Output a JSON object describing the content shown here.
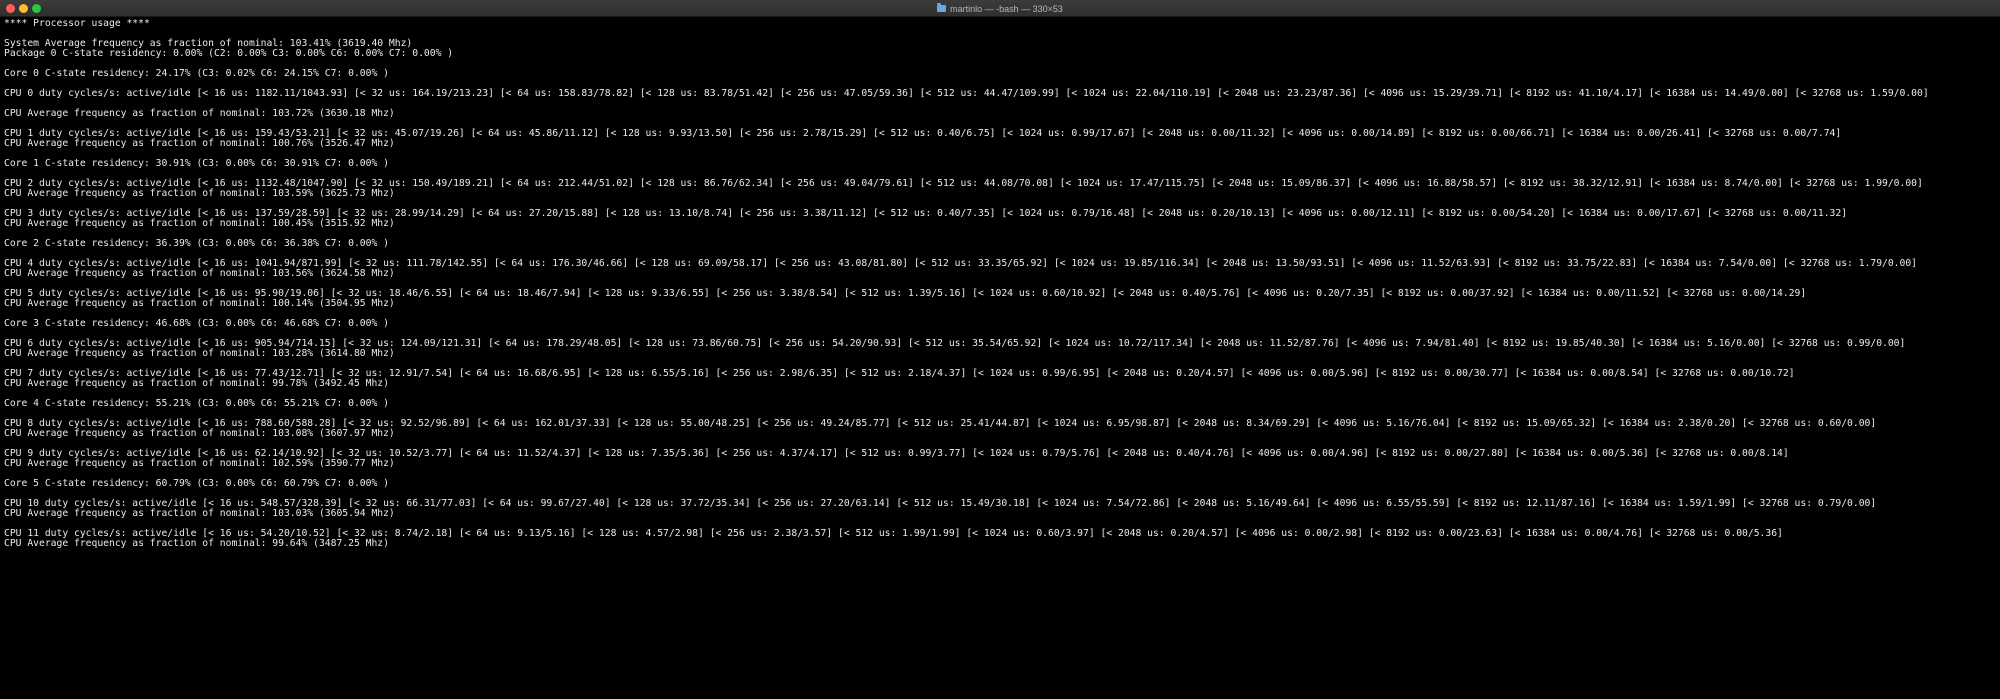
{
  "window": {
    "title": "martinlo — -bash — 330×53",
    "title_icon": "folder-icon",
    "colors": {
      "background": "#000000",
      "text": "#ebebeb",
      "titlebar": "#333333",
      "close": "#ff5f57",
      "minimize": "#febc2e",
      "maximize": "#28c840"
    }
  },
  "terminal": {
    "lines": [
      "**** Processor usage ****",
      "",
      "System Average frequency as fraction of nominal: 103.41% (3619.40 Mhz)",
      "Package 0 C-state residency: 0.00% (C2: 0.00% C3: 0.00% C6: 0.00% C7: 0.00% )",
      "",
      "Core 0 C-state residency: 24.17% (C3: 0.02% C6: 24.15% C7: 0.00% )",
      "",
      "CPU 0 duty cycles/s: active/idle [< 16 us: 1182.11/1043.93] [< 32 us: 164.19/213.23] [< 64 us: 158.83/78.82] [< 128 us: 83.78/51.42] [< 256 us: 47.05/59.36] [< 512 us: 44.47/109.99] [< 1024 us: 22.04/110.19] [< 2048 us: 23.23/87.36] [< 4096 us: 15.29/39.71] [< 8192 us: 41.10/4.17] [< 16384 us: 14.49/0.00] [< 32768 us: 1.59/0.00]",
      "",
      "CPU Average frequency as fraction of nominal: 103.72% (3630.18 Mhz)",
      "",
      "CPU 1 duty cycles/s: active/idle [< 16 us: 159.43/53.21] [< 32 us: 45.07/19.26] [< 64 us: 45.86/11.12] [< 128 us: 9.93/13.50] [< 256 us: 2.78/15.29] [< 512 us: 0.40/6.75] [< 1024 us: 0.99/17.67] [< 2048 us: 0.00/11.32] [< 4096 us: 0.00/14.89] [< 8192 us: 0.00/66.71] [< 16384 us: 0.00/26.41] [< 32768 us: 0.00/7.74]",
      "CPU Average frequency as fraction of nominal: 100.76% (3526.47 Mhz)",
      "",
      "Core 1 C-state residency: 30.91% (C3: 0.00% C6: 30.91% C7: 0.00% )",
      "",
      "CPU 2 duty cycles/s: active/idle [< 16 us: 1132.48/1047.90] [< 32 us: 150.49/189.21] [< 64 us: 212.44/51.02] [< 128 us: 86.76/62.34] [< 256 us: 49.04/79.61] [< 512 us: 44.08/70.08] [< 1024 us: 17.47/115.75] [< 2048 us: 15.09/86.37] [< 4096 us: 16.88/58.57] [< 8192 us: 38.32/12.91] [< 16384 us: 8.74/0.00] [< 32768 us: 1.99/0.00]",
      "CPU Average frequency as fraction of nominal: 103.59% (3625.73 Mhz)",
      "",
      "CPU 3 duty cycles/s: active/idle [< 16 us: 137.59/28.59] [< 32 us: 28.99/14.29] [< 64 us: 27.20/15.88] [< 128 us: 13.10/8.74] [< 256 us: 3.38/11.12] [< 512 us: 0.40/7.35] [< 1024 us: 0.79/16.48] [< 2048 us: 0.20/10.13] [< 4096 us: 0.00/12.11] [< 8192 us: 0.00/54.20] [< 16384 us: 0.00/17.67] [< 32768 us: 0.00/11.32]",
      "CPU Average frequency as fraction of nominal: 100.45% (3515.92 Mhz)",
      "",
      "Core 2 C-state residency: 36.39% (C3: 0.00% C6: 36.38% C7: 0.00% )",
      "",
      "CPU 4 duty cycles/s: active/idle [< 16 us: 1041.94/871.99] [< 32 us: 111.78/142.55] [< 64 us: 176.30/46.66] [< 128 us: 69.09/58.17] [< 256 us: 43.08/81.80] [< 512 us: 33.35/65.92] [< 1024 us: 19.85/116.34] [< 2048 us: 13.50/93.51] [< 4096 us: 11.52/63.93] [< 8192 us: 33.75/22.83] [< 16384 us: 7.54/0.00] [< 32768 us: 1.79/0.00]",
      "CPU Average frequency as fraction of nominal: 103.56% (3624.58 Mhz)",
      "",
      "CPU 5 duty cycles/s: active/idle [< 16 us: 95.90/19.06] [< 32 us: 18.46/6.55] [< 64 us: 18.46/7.94] [< 128 us: 9.33/6.55] [< 256 us: 3.38/8.54] [< 512 us: 1.39/5.16] [< 1024 us: 0.60/10.92] [< 2048 us: 0.40/5.76] [< 4096 us: 0.20/7.35] [< 8192 us: 0.00/37.92] [< 16384 us: 0.00/11.52] [< 32768 us: 0.00/14.29]",
      "CPU Average frequency as fraction of nominal: 100.14% (3504.95 Mhz)",
      "",
      "Core 3 C-state residency: 46.68% (C3: 0.00% C6: 46.68% C7: 0.00% )",
      "",
      "CPU 6 duty cycles/s: active/idle [< 16 us: 905.94/714.15] [< 32 us: 124.09/121.31] [< 64 us: 178.29/48.05] [< 128 us: 73.86/60.75] [< 256 us: 54.20/90.93] [< 512 us: 35.54/65.92] [< 1024 us: 10.72/117.34] [< 2048 us: 11.52/87.76] [< 4096 us: 7.94/81.40] [< 8192 us: 19.85/40.30] [< 16384 us: 5.16/0.00] [< 32768 us: 0.99/0.00]",
      "CPU Average frequency as fraction of nominal: 103.28% (3614.80 Mhz)",
      "",
      "CPU 7 duty cycles/s: active/idle [< 16 us: 77.43/12.71] [< 32 us: 12.91/7.54] [< 64 us: 16.68/6.95] [< 128 us: 6.55/5.16] [< 256 us: 2.98/6.35] [< 512 us: 2.18/4.37] [< 1024 us: 0.99/6.95] [< 2048 us: 0.20/4.57] [< 4096 us: 0.00/5.96] [< 8192 us: 0.00/30.77] [< 16384 us: 0.00/8.54] [< 32768 us: 0.00/10.72]",
      "CPU Average frequency as fraction of nominal: 99.78% (3492.45 Mhz)",
      "",
      "Core 4 C-state residency: 55.21% (C3: 0.00% C6: 55.21% C7: 0.00% )",
      "",
      "CPU 8 duty cycles/s: active/idle [< 16 us: 788.60/588.28] [< 32 us: 92.52/96.89] [< 64 us: 162.01/37.33] [< 128 us: 55.00/48.25] [< 256 us: 49.24/85.77] [< 512 us: 25.41/44.87] [< 1024 us: 6.95/98.87] [< 2048 us: 8.34/69.29] [< 4096 us: 5.16/76.04] [< 8192 us: 15.09/65.32] [< 16384 us: 2.38/0.20] [< 32768 us: 0.60/0.00]",
      "CPU Average frequency as fraction of nominal: 103.08% (3607.97 Mhz)",
      "",
      "CPU 9 duty cycles/s: active/idle [< 16 us: 62.14/10.92] [< 32 us: 10.52/3.77] [< 64 us: 11.52/4.37] [< 128 us: 7.35/5.36] [< 256 us: 4.37/4.17] [< 512 us: 0.99/3.77] [< 1024 us: 0.79/5.76] [< 2048 us: 0.40/4.76] [< 4096 us: 0.00/4.96] [< 8192 us: 0.00/27.80] [< 16384 us: 0.00/5.36] [< 32768 us: 0.00/8.14]",
      "CPU Average frequency as fraction of nominal: 102.59% (3590.77 Mhz)",
      "",
      "Core 5 C-state residency: 60.79% (C3: 0.00% C6: 60.79% C7: 0.00% )",
      "",
      "CPU 10 duty cycles/s: active/idle [< 16 us: 548.57/328.39] [< 32 us: 66.31/77.03] [< 64 us: 99.67/27.40] [< 128 us: 37.72/35.34] [< 256 us: 27.20/63.14] [< 512 us: 15.49/30.18] [< 1024 us: 7.54/72.86] [< 2048 us: 5.16/49.64] [< 4096 us: 6.55/55.59] [< 8192 us: 12.11/87.16] [< 16384 us: 1.59/1.99] [< 32768 us: 0.79/0.00]",
      "CPU Average frequency as fraction of nominal: 103.03% (3605.94 Mhz)",
      "",
      "CPU 11 duty cycles/s: active/idle [< 16 us: 54.20/10.52] [< 32 us: 8.74/2.18] [< 64 us: 9.13/5.16] [< 128 us: 4.57/2.98] [< 256 us: 2.38/3.57] [< 512 us: 1.99/1.99] [< 1024 us: 0.60/3.97] [< 2048 us: 0.20/4.57] [< 4096 us: 0.00/2.98] [< 8192 us: 0.00/23.63] [< 16384 us: 0.00/4.76] [< 32768 us: 0.00/5.36]",
      "CPU Average frequency as fraction of nominal: 99.64% (3487.25 Mhz)"
    ]
  }
}
